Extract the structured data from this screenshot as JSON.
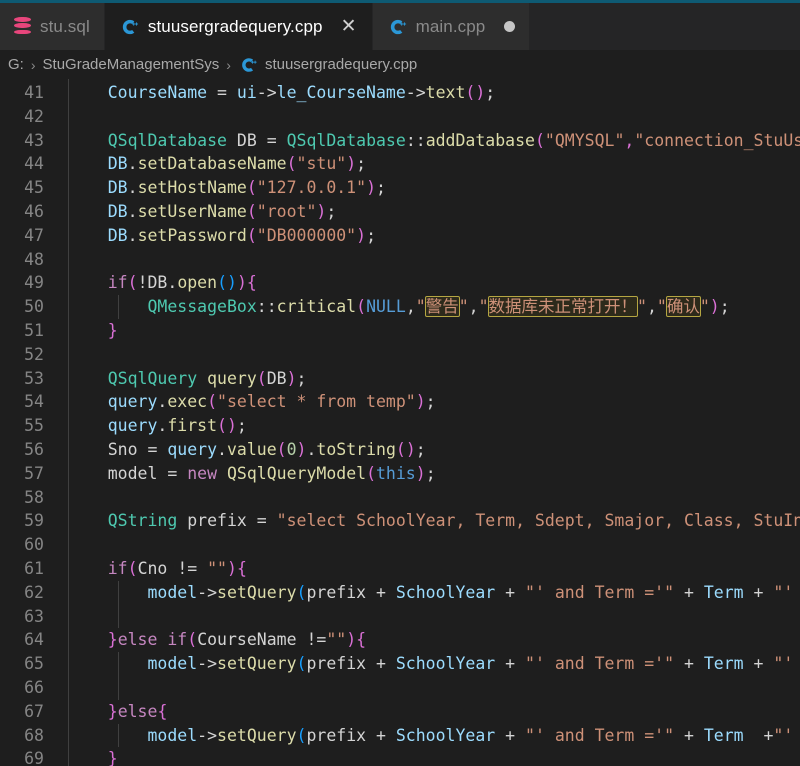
{
  "window": {
    "accent_color": "#0e5a73",
    "background": "#1e1e1e"
  },
  "tabs": [
    {
      "label": "stu.sql",
      "icon": "database-icon",
      "active": false,
      "dirty": false,
      "closable": false
    },
    {
      "label": "stuusergradequery.cpp",
      "icon": "cpp-file-icon",
      "active": true,
      "dirty": false,
      "closable": true,
      "close_glyph": "✕"
    },
    {
      "label": "main.cpp",
      "icon": "cpp-file-icon",
      "active": false,
      "dirty": true,
      "closable": false
    }
  ],
  "breadcrumb": {
    "separator": "›",
    "items": [
      {
        "label": "G:",
        "icon": null
      },
      {
        "label": "StuGradeManagementSys",
        "icon": null
      },
      {
        "label": "stuusergradequery.cpp",
        "icon": "cpp-file-icon"
      }
    ]
  },
  "editor": {
    "first_line": 41,
    "last_line": 69,
    "language": "C++",
    "lines": [
      {
        "n": 41,
        "tokens": [
          {
            "t": "CourseName",
            "c": "t-var"
          },
          {
            "t": " = ",
            "c": "t-op"
          },
          {
            "t": "ui",
            "c": "t-var"
          },
          {
            "t": "->",
            "c": "t-op"
          },
          {
            "t": "le_CourseName",
            "c": "t-var"
          },
          {
            "t": "->",
            "c": "t-op"
          },
          {
            "t": "text",
            "c": "t-fn"
          },
          {
            "t": "(",
            "c": "t-paren2"
          },
          {
            "t": ")",
            "c": "t-paren2"
          },
          {
            "t": ";",
            "c": "t-punc"
          }
        ]
      },
      {
        "n": 42,
        "tokens": []
      },
      {
        "n": 43,
        "tokens": [
          {
            "t": "QSqlDatabase",
            "c": "t-type"
          },
          {
            "t": " DB ",
            "c": "t-plain"
          },
          {
            "t": "= ",
            "c": "t-op"
          },
          {
            "t": "QSqlDatabase",
            "c": "t-type"
          },
          {
            "t": "::",
            "c": "t-plain"
          },
          {
            "t": "addDatabase",
            "c": "t-fn"
          },
          {
            "t": "(",
            "c": "t-paren2"
          },
          {
            "t": "\"QMYSQL\"",
            "c": "t-str"
          },
          {
            "t": ",",
            "c": "t-paren2"
          },
          {
            "t": "\"connection_StuUser",
            "c": "t-str"
          }
        ]
      },
      {
        "n": 44,
        "tokens": [
          {
            "t": "DB",
            "c": "t-var"
          },
          {
            "t": ".",
            "c": "t-plain"
          },
          {
            "t": "setDatabaseName",
            "c": "t-fn"
          },
          {
            "t": "(",
            "c": "t-paren2"
          },
          {
            "t": "\"stu\"",
            "c": "t-str"
          },
          {
            "t": ")",
            "c": "t-paren2"
          },
          {
            "t": ";",
            "c": "t-punc"
          }
        ]
      },
      {
        "n": 45,
        "tokens": [
          {
            "t": "DB",
            "c": "t-var"
          },
          {
            "t": ".",
            "c": "t-plain"
          },
          {
            "t": "setHostName",
            "c": "t-fn"
          },
          {
            "t": "(",
            "c": "t-paren2"
          },
          {
            "t": "\"127.0.0.1\"",
            "c": "t-str"
          },
          {
            "t": ")",
            "c": "t-paren2"
          },
          {
            "t": ";",
            "c": "t-punc"
          }
        ]
      },
      {
        "n": 46,
        "tokens": [
          {
            "t": "DB",
            "c": "t-var"
          },
          {
            "t": ".",
            "c": "t-plain"
          },
          {
            "t": "setUserName",
            "c": "t-fn"
          },
          {
            "t": "(",
            "c": "t-paren2"
          },
          {
            "t": "\"root\"",
            "c": "t-str"
          },
          {
            "t": ")",
            "c": "t-paren2"
          },
          {
            "t": ";",
            "c": "t-punc"
          }
        ]
      },
      {
        "n": 47,
        "tokens": [
          {
            "t": "DB",
            "c": "t-var"
          },
          {
            "t": ".",
            "c": "t-plain"
          },
          {
            "t": "setPassword",
            "c": "t-fn"
          },
          {
            "t": "(",
            "c": "t-paren2"
          },
          {
            "t": "\"DB000000\"",
            "c": "t-str"
          },
          {
            "t": ")",
            "c": "t-paren2"
          },
          {
            "t": ";",
            "c": "t-punc"
          }
        ]
      },
      {
        "n": 48,
        "tokens": []
      },
      {
        "n": 49,
        "tokens": [
          {
            "t": "if",
            "c": "t-kw"
          },
          {
            "t": "(",
            "c": "t-paren2"
          },
          {
            "t": "!",
            "c": "t-op"
          },
          {
            "t": "DB",
            "c": "t-plain"
          },
          {
            "t": ".",
            "c": "t-plain"
          },
          {
            "t": "open",
            "c": "t-fn"
          },
          {
            "t": "(",
            "c": "t-paren3"
          },
          {
            "t": ")",
            "c": "t-paren3"
          },
          {
            "t": ")",
            "c": "t-paren2"
          },
          {
            "t": "{",
            "c": "t-paren2"
          }
        ]
      },
      {
        "n": 50,
        "tokens": [
          {
            "t": "QMessageBox",
            "c": "t-type"
          },
          {
            "t": "::",
            "c": "t-plain"
          },
          {
            "t": "critical",
            "c": "t-fn"
          },
          {
            "t": "(",
            "c": "t-paren2"
          },
          {
            "t": "NULL",
            "c": "t-const"
          },
          {
            "t": ",",
            "c": "t-punc"
          },
          {
            "t": "\"",
            "c": "t-str"
          },
          {
            "t": "警告",
            "c": "t-str",
            "hl": true
          },
          {
            "t": "\"",
            "c": "t-str"
          },
          {
            "t": ",",
            "c": "t-punc"
          },
          {
            "t": "\"",
            "c": "t-str"
          },
          {
            "t": "数据库未正常打开！",
            "c": "t-str",
            "hl": true
          },
          {
            "t": "\"",
            "c": "t-str"
          },
          {
            "t": ",",
            "c": "t-punc"
          },
          {
            "t": "\"",
            "c": "t-str"
          },
          {
            "t": "确认",
            "c": "t-str",
            "hl": true
          },
          {
            "t": "\"",
            "c": "t-str"
          },
          {
            "t": ")",
            "c": "t-paren2"
          },
          {
            "t": ";",
            "c": "t-punc"
          }
        ]
      },
      {
        "n": 51,
        "tokens": [
          {
            "t": "}",
            "c": "t-paren2"
          }
        ]
      },
      {
        "n": 52,
        "tokens": []
      },
      {
        "n": 53,
        "tokens": [
          {
            "t": "QSqlQuery",
            "c": "t-type"
          },
          {
            "t": " query",
            "c": "t-fn"
          },
          {
            "t": "(",
            "c": "t-paren2"
          },
          {
            "t": "DB",
            "c": "t-plain"
          },
          {
            "t": ")",
            "c": "t-paren2"
          },
          {
            "t": ";",
            "c": "t-punc"
          }
        ]
      },
      {
        "n": 54,
        "tokens": [
          {
            "t": "query",
            "c": "t-var"
          },
          {
            "t": ".",
            "c": "t-plain"
          },
          {
            "t": "exec",
            "c": "t-fn"
          },
          {
            "t": "(",
            "c": "t-paren2"
          },
          {
            "t": "\"select * from temp\"",
            "c": "t-str"
          },
          {
            "t": ")",
            "c": "t-paren2"
          },
          {
            "t": ";",
            "c": "t-punc"
          }
        ]
      },
      {
        "n": 55,
        "tokens": [
          {
            "t": "query",
            "c": "t-var"
          },
          {
            "t": ".",
            "c": "t-plain"
          },
          {
            "t": "first",
            "c": "t-fn"
          },
          {
            "t": "(",
            "c": "t-paren2"
          },
          {
            "t": ")",
            "c": "t-paren2"
          },
          {
            "t": ";",
            "c": "t-punc"
          }
        ]
      },
      {
        "n": 56,
        "tokens": [
          {
            "t": "Sno ",
            "c": "t-plain"
          },
          {
            "t": "= ",
            "c": "t-op"
          },
          {
            "t": "query",
            "c": "t-var"
          },
          {
            "t": ".",
            "c": "t-plain"
          },
          {
            "t": "value",
            "c": "t-fn"
          },
          {
            "t": "(",
            "c": "t-paren2"
          },
          {
            "t": "0",
            "c": "t-num"
          },
          {
            "t": ")",
            "c": "t-paren2"
          },
          {
            "t": ".",
            "c": "t-plain"
          },
          {
            "t": "toString",
            "c": "t-fn"
          },
          {
            "t": "(",
            "c": "t-paren2"
          },
          {
            "t": ")",
            "c": "t-paren2"
          },
          {
            "t": ";",
            "c": "t-punc"
          }
        ]
      },
      {
        "n": 57,
        "tokens": [
          {
            "t": "model ",
            "c": "t-plain"
          },
          {
            "t": "= ",
            "c": "t-op"
          },
          {
            "t": "new",
            "c": "t-kw"
          },
          {
            "t": " ",
            "c": "t-plain"
          },
          {
            "t": "QSqlQueryModel",
            "c": "t-fn"
          },
          {
            "t": "(",
            "c": "t-paren2"
          },
          {
            "t": "this",
            "c": "t-const"
          },
          {
            "t": ")",
            "c": "t-paren2"
          },
          {
            "t": ";",
            "c": "t-punc"
          }
        ]
      },
      {
        "n": 58,
        "tokens": []
      },
      {
        "n": 59,
        "tokens": [
          {
            "t": "QString",
            "c": "t-type"
          },
          {
            "t": " prefix ",
            "c": "t-plain"
          },
          {
            "t": "= ",
            "c": "t-op"
          },
          {
            "t": "\"select SchoolYear, Term, Sdept, Smajor, Class, StuInfo",
            "c": "t-str"
          }
        ]
      },
      {
        "n": 60,
        "tokens": []
      },
      {
        "n": 61,
        "tokens": [
          {
            "t": "if",
            "c": "t-kw"
          },
          {
            "t": "(",
            "c": "t-paren2"
          },
          {
            "t": "Cno ",
            "c": "t-plain"
          },
          {
            "t": "!= ",
            "c": "t-op"
          },
          {
            "t": "\"\"",
            "c": "t-str"
          },
          {
            "t": ")",
            "c": "t-paren2"
          },
          {
            "t": "{",
            "c": "t-paren2"
          }
        ]
      },
      {
        "n": 62,
        "tokens": [
          {
            "t": "model",
            "c": "t-var"
          },
          {
            "t": "->",
            "c": "t-op"
          },
          {
            "t": "setQuery",
            "c": "t-fn"
          },
          {
            "t": "(",
            "c": "t-paren3"
          },
          {
            "t": "prefix ",
            "c": "t-plain"
          },
          {
            "t": "+ ",
            "c": "t-op"
          },
          {
            "t": "SchoolYear ",
            "c": "t-var"
          },
          {
            "t": "+ ",
            "c": "t-op"
          },
          {
            "t": "\"' and Term ='\"",
            "c": "t-str"
          },
          {
            "t": " + ",
            "c": "t-op"
          },
          {
            "t": "Term",
            "c": "t-var"
          },
          {
            "t": " + ",
            "c": "t-op"
          },
          {
            "t": "\"' an",
            "c": "t-str"
          }
        ]
      },
      {
        "n": 63,
        "tokens": []
      },
      {
        "n": 64,
        "tokens": [
          {
            "t": "}",
            "c": "t-paren2"
          },
          {
            "t": "else",
            "c": "t-kw"
          },
          {
            "t": " ",
            "c": "t-plain"
          },
          {
            "t": "if",
            "c": "t-kw"
          },
          {
            "t": "(",
            "c": "t-paren2"
          },
          {
            "t": "CourseName ",
            "c": "t-plain"
          },
          {
            "t": "!=",
            "c": "t-op"
          },
          {
            "t": "\"\"",
            "c": "t-str"
          },
          {
            "t": ")",
            "c": "t-paren2"
          },
          {
            "t": "{",
            "c": "t-paren2"
          }
        ]
      },
      {
        "n": 65,
        "tokens": [
          {
            "t": "model",
            "c": "t-var"
          },
          {
            "t": "->",
            "c": "t-op"
          },
          {
            "t": "setQuery",
            "c": "t-fn"
          },
          {
            "t": "(",
            "c": "t-paren3"
          },
          {
            "t": "prefix ",
            "c": "t-plain"
          },
          {
            "t": "+ ",
            "c": "t-op"
          },
          {
            "t": "SchoolYear ",
            "c": "t-var"
          },
          {
            "t": "+ ",
            "c": "t-op"
          },
          {
            "t": "\"' and Term ='\"",
            "c": "t-str"
          },
          {
            "t": " + ",
            "c": "t-op"
          },
          {
            "t": "Term",
            "c": "t-var"
          },
          {
            "t": " + ",
            "c": "t-op"
          },
          {
            "t": "\"' an",
            "c": "t-str"
          }
        ]
      },
      {
        "n": 66,
        "tokens": []
      },
      {
        "n": 67,
        "tokens": [
          {
            "t": "}",
            "c": "t-paren2"
          },
          {
            "t": "else",
            "c": "t-kw"
          },
          {
            "t": "{",
            "c": "t-paren2"
          }
        ]
      },
      {
        "n": 68,
        "tokens": [
          {
            "t": "model",
            "c": "t-var"
          },
          {
            "t": "->",
            "c": "t-op"
          },
          {
            "t": "setQuery",
            "c": "t-fn"
          },
          {
            "t": "(",
            "c": "t-paren3"
          },
          {
            "t": "prefix ",
            "c": "t-plain"
          },
          {
            "t": "+ ",
            "c": "t-op"
          },
          {
            "t": "SchoolYear ",
            "c": "t-var"
          },
          {
            "t": "+ ",
            "c": "t-op"
          },
          {
            "t": "\"' and Term ='\"",
            "c": "t-str"
          },
          {
            "t": " + ",
            "c": "t-op"
          },
          {
            "t": "Term ",
            "c": "t-var"
          },
          {
            "t": " +",
            "c": "t-op"
          },
          {
            "t": "\"' an",
            "c": "t-str"
          }
        ]
      },
      {
        "n": 69,
        "tokens": [
          {
            "t": "}",
            "c": "t-paren2"
          }
        ]
      }
    ],
    "indents": [
      {
        "line": 41,
        "level": 1
      },
      {
        "line": 42,
        "level": 1
      },
      {
        "line": 43,
        "level": 1
      },
      {
        "line": 44,
        "level": 1
      },
      {
        "line": 45,
        "level": 1
      },
      {
        "line": 46,
        "level": 1
      },
      {
        "line": 47,
        "level": 1
      },
      {
        "line": 48,
        "level": 1
      },
      {
        "line": 49,
        "level": 1
      },
      {
        "line": 50,
        "level": 2
      },
      {
        "line": 51,
        "level": 1
      },
      {
        "line": 52,
        "level": 1
      },
      {
        "line": 53,
        "level": 1
      },
      {
        "line": 54,
        "level": 1
      },
      {
        "line": 55,
        "level": 1
      },
      {
        "line": 56,
        "level": 1
      },
      {
        "line": 57,
        "level": 1
      },
      {
        "line": 58,
        "level": 1
      },
      {
        "line": 59,
        "level": 1
      },
      {
        "line": 60,
        "level": 1
      },
      {
        "line": 61,
        "level": 1
      },
      {
        "line": 62,
        "level": 2
      },
      {
        "line": 63,
        "level": 2
      },
      {
        "line": 64,
        "level": 1
      },
      {
        "line": 65,
        "level": 2
      },
      {
        "line": 66,
        "level": 2
      },
      {
        "line": 67,
        "level": 1
      },
      {
        "line": 68,
        "level": 2
      },
      {
        "line": 69,
        "level": 1
      }
    ]
  },
  "colors": {
    "keyword": "#c586c0",
    "type": "#4ec9b0",
    "variable": "#9cdcfe",
    "function": "#dcdcaa",
    "string": "#ce9178",
    "number": "#b5cea8",
    "constant": "#569cd6",
    "line_number": "#858585",
    "find_match_border": "#b5a642",
    "editor_bg": "#1e1e1e",
    "tab_inactive_bg": "#2d2d2d",
    "tab_bar_bg": "#252526",
    "db_icon": "#e8467c",
    "cpp_icon": "#2b97d6"
  }
}
